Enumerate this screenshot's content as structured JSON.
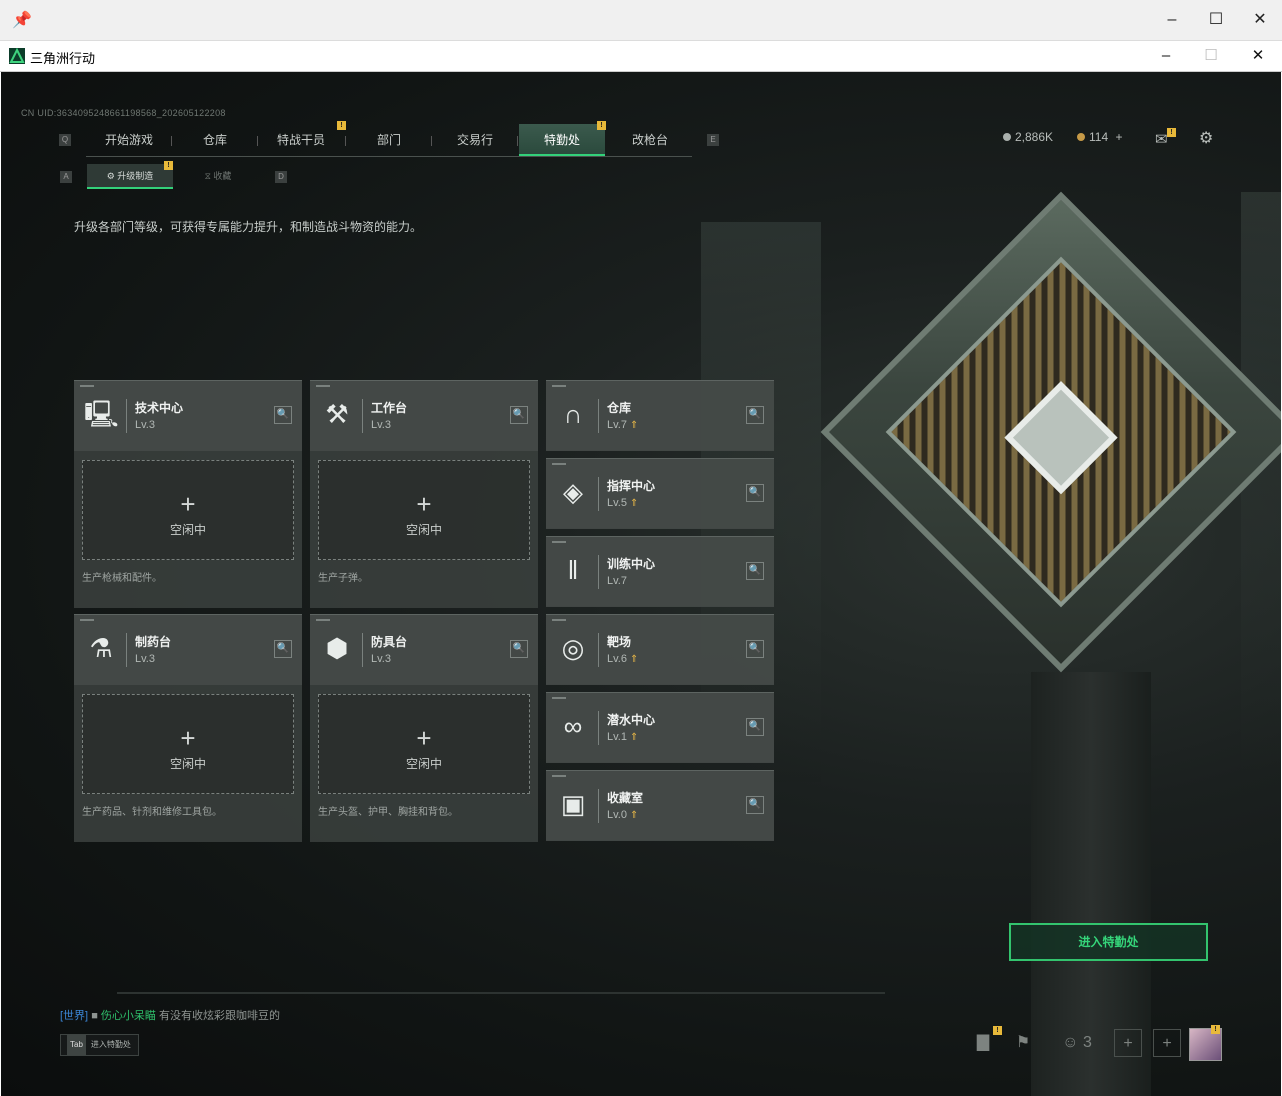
{
  "outer_window": {
    "pin_icon": "pin-icon"
  },
  "window": {
    "title": "三角洲行动"
  },
  "uid": "CN UID:3634095248661198568_202605122208",
  "nav": {
    "tabs": [
      {
        "label": "开始游戏"
      },
      {
        "label": "仓库"
      },
      {
        "label": "特战干员"
      },
      {
        "label": "部门"
      },
      {
        "label": "交易行"
      },
      {
        "label": "特勤处"
      },
      {
        "label": "改枪台"
      }
    ],
    "keys": {
      "left": "Q",
      "right": "E"
    },
    "notice_mark": "!"
  },
  "subnav": {
    "tabs": [
      {
        "label": "升级制造"
      },
      {
        "label": "收藏"
      }
    ],
    "keys": {
      "left": "A",
      "right": "D"
    }
  },
  "description": "升级各部门等级，可获得专属能力提升，和制造战斗物资的能力。",
  "hud": {
    "currency1": "2,886K",
    "currency2": "114",
    "plus": "+"
  },
  "workbenches": [
    {
      "name": "技术中心",
      "level": "Lv.3",
      "idle_label": "空闲中",
      "desc": "生产枪械和配件。"
    },
    {
      "name": "工作台",
      "level": "Lv.3",
      "idle_label": "空闲中",
      "desc": "生产子弹。"
    },
    {
      "name": "制药台",
      "level": "Lv.3",
      "idle_label": "空闲中",
      "desc": "生产药品、针剂和维修工具包。"
    },
    {
      "name": "防具台",
      "level": "Lv.3",
      "idle_label": "空闲中",
      "desc": "生产头盔、护甲、胸挂和背包。"
    }
  ],
  "facilities": [
    {
      "name": "仓库",
      "level": "Lv.7"
    },
    {
      "name": "指挥中心",
      "level": "Lv.5"
    },
    {
      "name": "训练中心",
      "level": "Lv.7"
    },
    {
      "name": "靶场",
      "level": "Lv.6"
    },
    {
      "name": "潜水中心",
      "level": "Lv.1"
    },
    {
      "name": "收藏室",
      "level": "Lv.0"
    }
  ],
  "upgrade_mark": "⇑",
  "enter_button": "进入特勤处",
  "chat": {
    "channel": "[世界]",
    "name": "伤心小呆瞄",
    "message": "有没有收炫彩跟咖啡豆的"
  },
  "tab_hint": {
    "key": "Tab",
    "label": "进入特勤处"
  },
  "bottom": {
    "friends_count": "3"
  },
  "colors": {
    "accent": "#33d17a",
    "upgrade": "#e4b448",
    "notice": "#e8b93a"
  }
}
